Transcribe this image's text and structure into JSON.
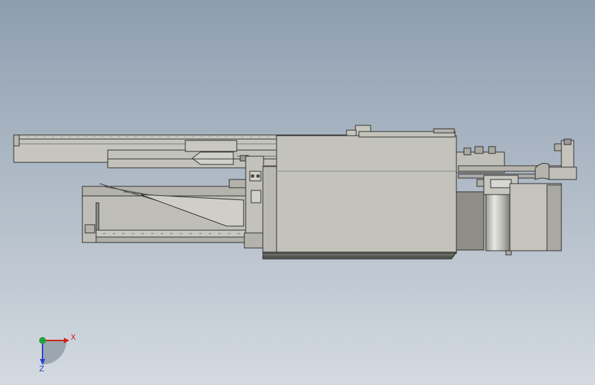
{
  "background": {
    "top": "#8e9eb0",
    "bottom": "#d4dae0"
  },
  "model": {
    "body_color": "#c4c4bc",
    "edge_color": "#2e2e2e",
    "dark_color": "#55554f",
    "shadow_color": "#8a8a82"
  },
  "triad": {
    "x_label": "X",
    "z_label": "Z",
    "x_color": "#d21e1e",
    "y_color": "#1fa23a",
    "z_color": "#2a3fd6"
  }
}
